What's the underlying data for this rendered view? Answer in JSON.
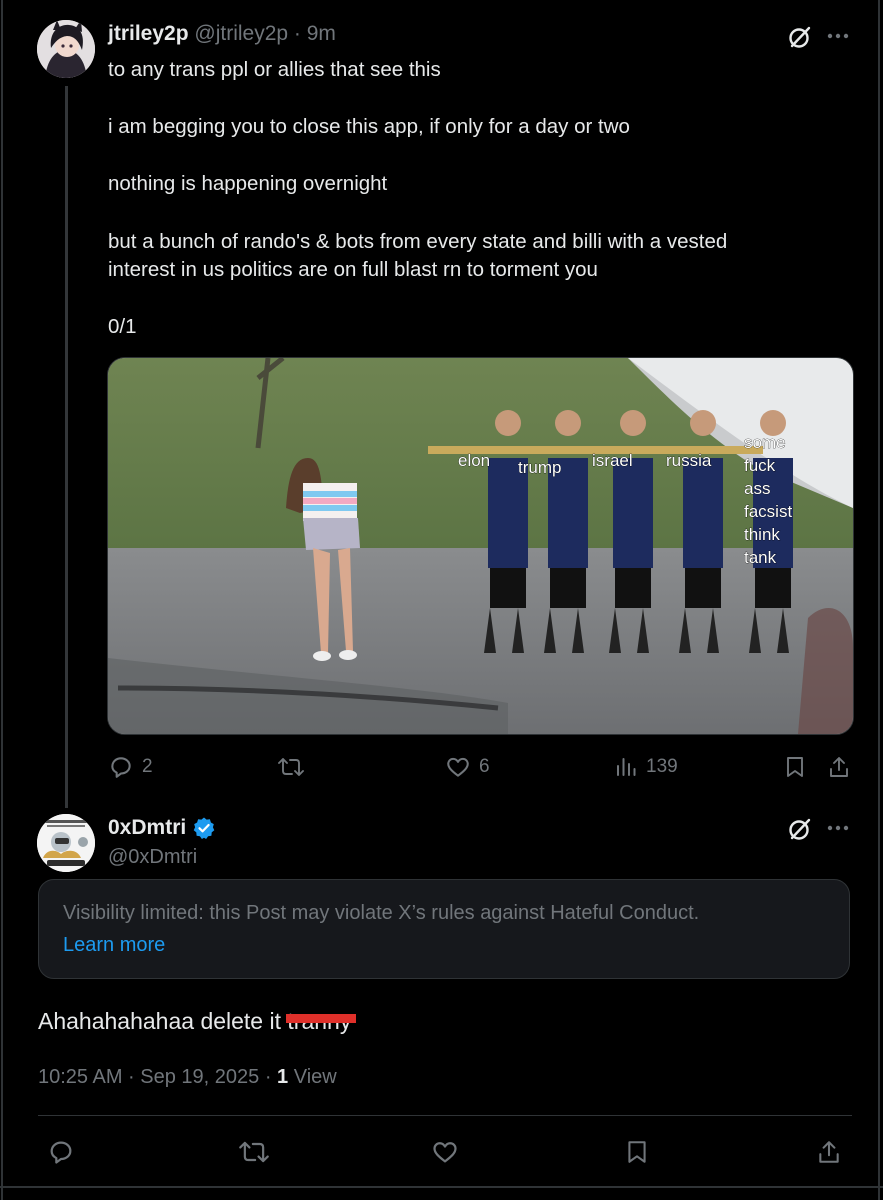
{
  "post1": {
    "display_name": "jtriley2p",
    "handle": "@jtriley2p",
    "time": "· 9m",
    "text_lines": [
      "to any trans ppl or allies that see this",
      "i am begging you to close this app, if only for a day or two",
      "nothing is happening overnight",
      "but a bunch of rando's & bots from every state and billi with a vested interest in us politics are on full blast rn to torment you",
      "0/1"
    ],
    "meme_labels": [
      "elon",
      "trump",
      "israel",
      "russia",
      "some",
      "fuck",
      "ass",
      "facsist",
      "think",
      "tank"
    ],
    "actions": {
      "replies": "2",
      "reposts": "",
      "likes": "6",
      "views": "139"
    }
  },
  "post2": {
    "display_name": "0xDmtri",
    "handle": "@0xDmtri",
    "verified": true,
    "notice_text": "Visibility limited: this Post may violate X’s rules against Hateful Conduct.",
    "learn_more": "Learn more",
    "body_text": "Ahahahahahaa delete it t",
    "body_redacted": "ranny",
    "timestamp": "10:25 AM · Sep 19, 2025 · ",
    "view_count": "1",
    "view_label": " View"
  },
  "colors": {
    "background": "#000000",
    "text_primary": "#e7e9ea",
    "text_muted": "#71767b",
    "link": "#1d9bf0",
    "verified": "#1d9bf0",
    "notice_bg": "#16181c",
    "redaction": "#e0302a"
  },
  "icons": [
    "grok-icon",
    "more-icon",
    "reply-icon",
    "repost-icon",
    "like-icon",
    "views-icon",
    "bookmark-icon",
    "share-icon",
    "verified-badge-icon"
  ]
}
